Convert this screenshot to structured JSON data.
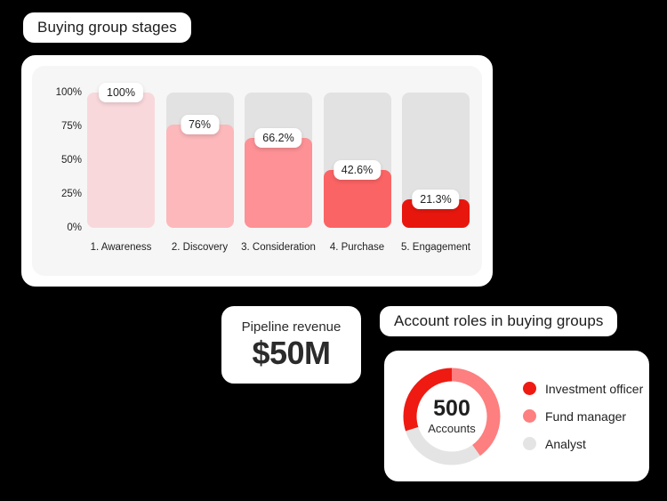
{
  "bar_section": {
    "title": "Buying group stages"
  },
  "revenue_card": {
    "title": "Pipeline revenue",
    "value": "$50M"
  },
  "donut_section": {
    "title": "Account roles in buying groups",
    "center_value": "500",
    "center_caption": "Accounts"
  },
  "colors": {
    "card_border": "#000000",
    "card_background": "#ffffff",
    "chart_panel": "#f6f6f6",
    "track": "#e2e2e2",
    "bar_1": "#f9d8dc",
    "bar_2": "#fcb8bb",
    "bar_3": "#fd9195",
    "bar_4": "#fb6464",
    "bar_5": "#e8170e",
    "donut_investment_officer": "#ef1a12",
    "donut_fund_manager": "#fd7f7f",
    "donut_analyst": "#e4e4e4"
  },
  "chart_data": [
    {
      "type": "bar",
      "title": "Buying group stages",
      "xlabel": "",
      "ylabel": "",
      "ylim": [
        0,
        100
      ],
      "grid": false,
      "legend": "none",
      "ytick_labels": [
        "100%",
        "75%",
        "50%",
        "25%",
        "0%"
      ],
      "ytick_values": [
        100,
        75,
        50,
        25,
        0
      ],
      "categories": [
        "1. Awareness",
        "2. Discovery",
        "3. Consideration",
        "4. Purchase",
        "5. Engagement"
      ],
      "values": [
        100,
        76,
        66.2,
        42.6,
        21.3
      ],
      "data_labels": [
        "100%",
        "76%",
        "66.2%",
        "42.6%",
        "21.3%"
      ],
      "bar_colors": [
        "#f9d8dc",
        "#fcb8bb",
        "#fd9195",
        "#fb6464",
        "#e8170e"
      ],
      "track_color": "#e2e2e2",
      "track_max": 100
    },
    {
      "type": "pie",
      "subtype": "donut",
      "title": "Account roles in buying groups",
      "center_value": "500",
      "center_caption": "Accounts",
      "legend": "right",
      "labels": [
        "Investment officer",
        "Fund manager",
        "Analyst"
      ],
      "values": [
        30,
        40,
        30
      ],
      "colors": [
        "#ef1a12",
        "#fd7f7f",
        "#e4e4e4"
      ]
    }
  ]
}
